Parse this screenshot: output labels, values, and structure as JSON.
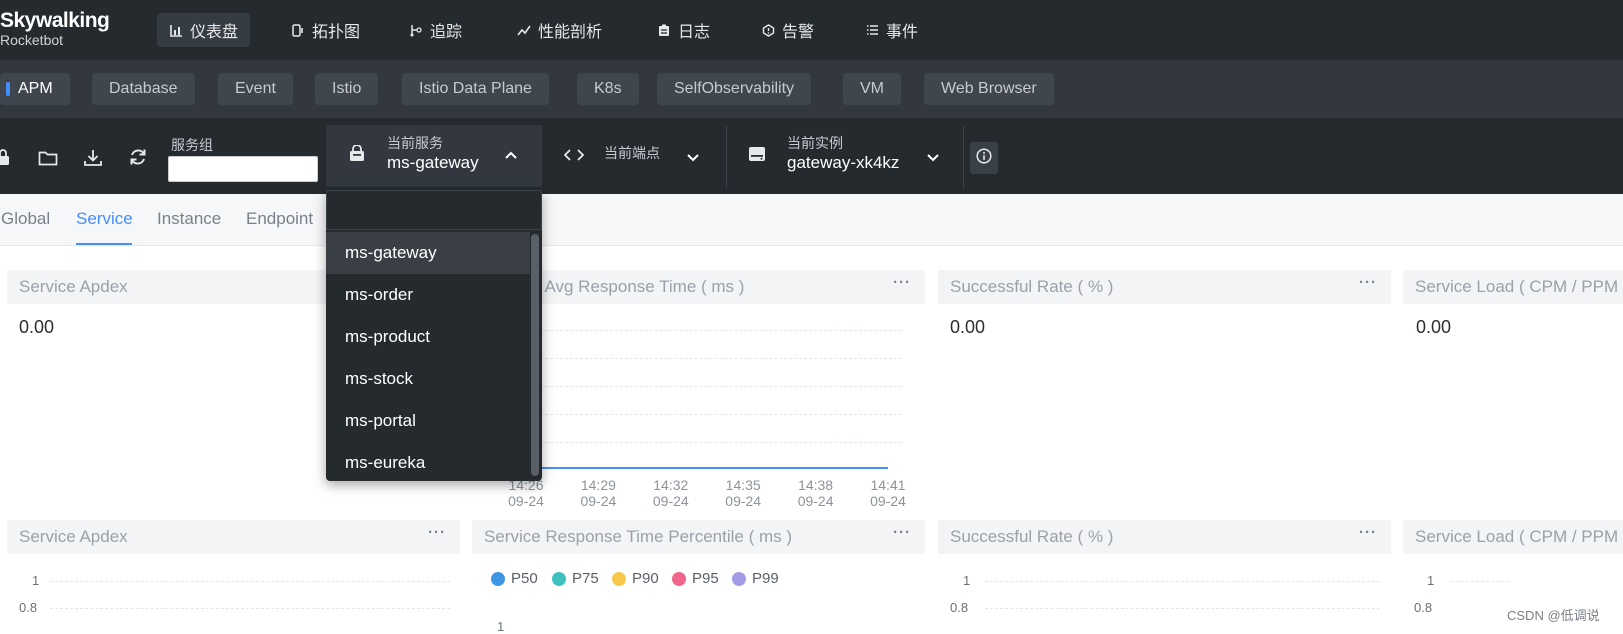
{
  "logo": {
    "main": "Skywalking",
    "sub": "Rocketbot"
  },
  "nav": [
    {
      "label": "仪表盘",
      "icon": "dashboard-icon",
      "active": true
    },
    {
      "label": "拓扑图",
      "icon": "topology-icon"
    },
    {
      "label": "追踪",
      "icon": "trace-icon"
    },
    {
      "label": "性能剖析",
      "icon": "profile-icon"
    },
    {
      "label": "日志",
      "icon": "log-icon"
    },
    {
      "label": "告警",
      "icon": "alarm-icon"
    },
    {
      "label": "事件",
      "icon": "event-icon"
    }
  ],
  "templates": [
    "APM",
    "Database",
    "Event",
    "Istio",
    "Istio Data Plane",
    "K8s",
    "SelfObservability",
    "VM",
    "Web Browser"
  ],
  "toolbar": {
    "group_label": "服务组",
    "service_label": "当前服务",
    "service_value": "ms-gateway",
    "endpoint_label": "当前端点",
    "instance_label": "当前实例",
    "instance_value": "gateway-xk4kz"
  },
  "subtabs": [
    "Global",
    "Service",
    "Instance",
    "Endpoint"
  ],
  "dropdown": {
    "items": [
      "ms-gateway",
      "ms-order",
      "ms-product",
      "ms-stock",
      "ms-portal",
      "ms-eureka"
    ]
  },
  "cards_row1": [
    {
      "title": "Service Apdex",
      "value": "0.00"
    },
    {
      "title": "Service Avg Response Time ( ms )"
    },
    {
      "title": "Successful Rate ( % )",
      "value": "0.00"
    },
    {
      "title": "Service Load ( CPM / PPM )",
      "value": "0.00"
    }
  ],
  "cards_row2": [
    {
      "title": "Service Apdex"
    },
    {
      "title": "Service Response Time Percentile ( ms )"
    },
    {
      "title": "Successful Rate ( % )"
    },
    {
      "title": "Service Load ( CPM / PPM )"
    }
  ],
  "more_label": "···",
  "chart_data": [
    {
      "type": "line",
      "title": "Service Avg Response Time ( ms )",
      "x": [
        "14:26\n09-24",
        "14:29\n09-24",
        "14:32\n09-24",
        "14:35\n09-24",
        "14:38\n09-24",
        "14:41\n09-24"
      ],
      "x_labels": [
        {
          "time": "14:26",
          "date": "09-24"
        },
        {
          "time": "14:29",
          "date": "09-24"
        },
        {
          "time": "14:32",
          "date": "09-24"
        },
        {
          "time": "14:35",
          "date": "09-24"
        },
        {
          "time": "14:38",
          "date": "09-24"
        },
        {
          "time": "14:41",
          "date": "09-24"
        }
      ],
      "series": [
        {
          "values": [
            0,
            0,
            0,
            0,
            0,
            0
          ],
          "color": "#448dfe"
        }
      ]
    },
    {
      "type": "line",
      "title": "Service Response Time Percentile ( ms )",
      "series": [
        {
          "name": "P50",
          "color": "#3f96e4"
        },
        {
          "name": "P75",
          "color": "#3ec1be"
        },
        {
          "name": "P90",
          "color": "#f5c84b"
        },
        {
          "name": "P95",
          "color": "#f0668a"
        },
        {
          "name": "P99",
          "color": "#a29ce6"
        }
      ],
      "y_ticks": [
        "1"
      ]
    }
  ],
  "apdex_y_ticks": [
    "1",
    "0.8"
  ],
  "rate_y_ticks": [
    "1",
    "0.8"
  ],
  "load_y_ticks": [
    "1",
    "0.8"
  ],
  "watermark": "CSDN @低调说"
}
